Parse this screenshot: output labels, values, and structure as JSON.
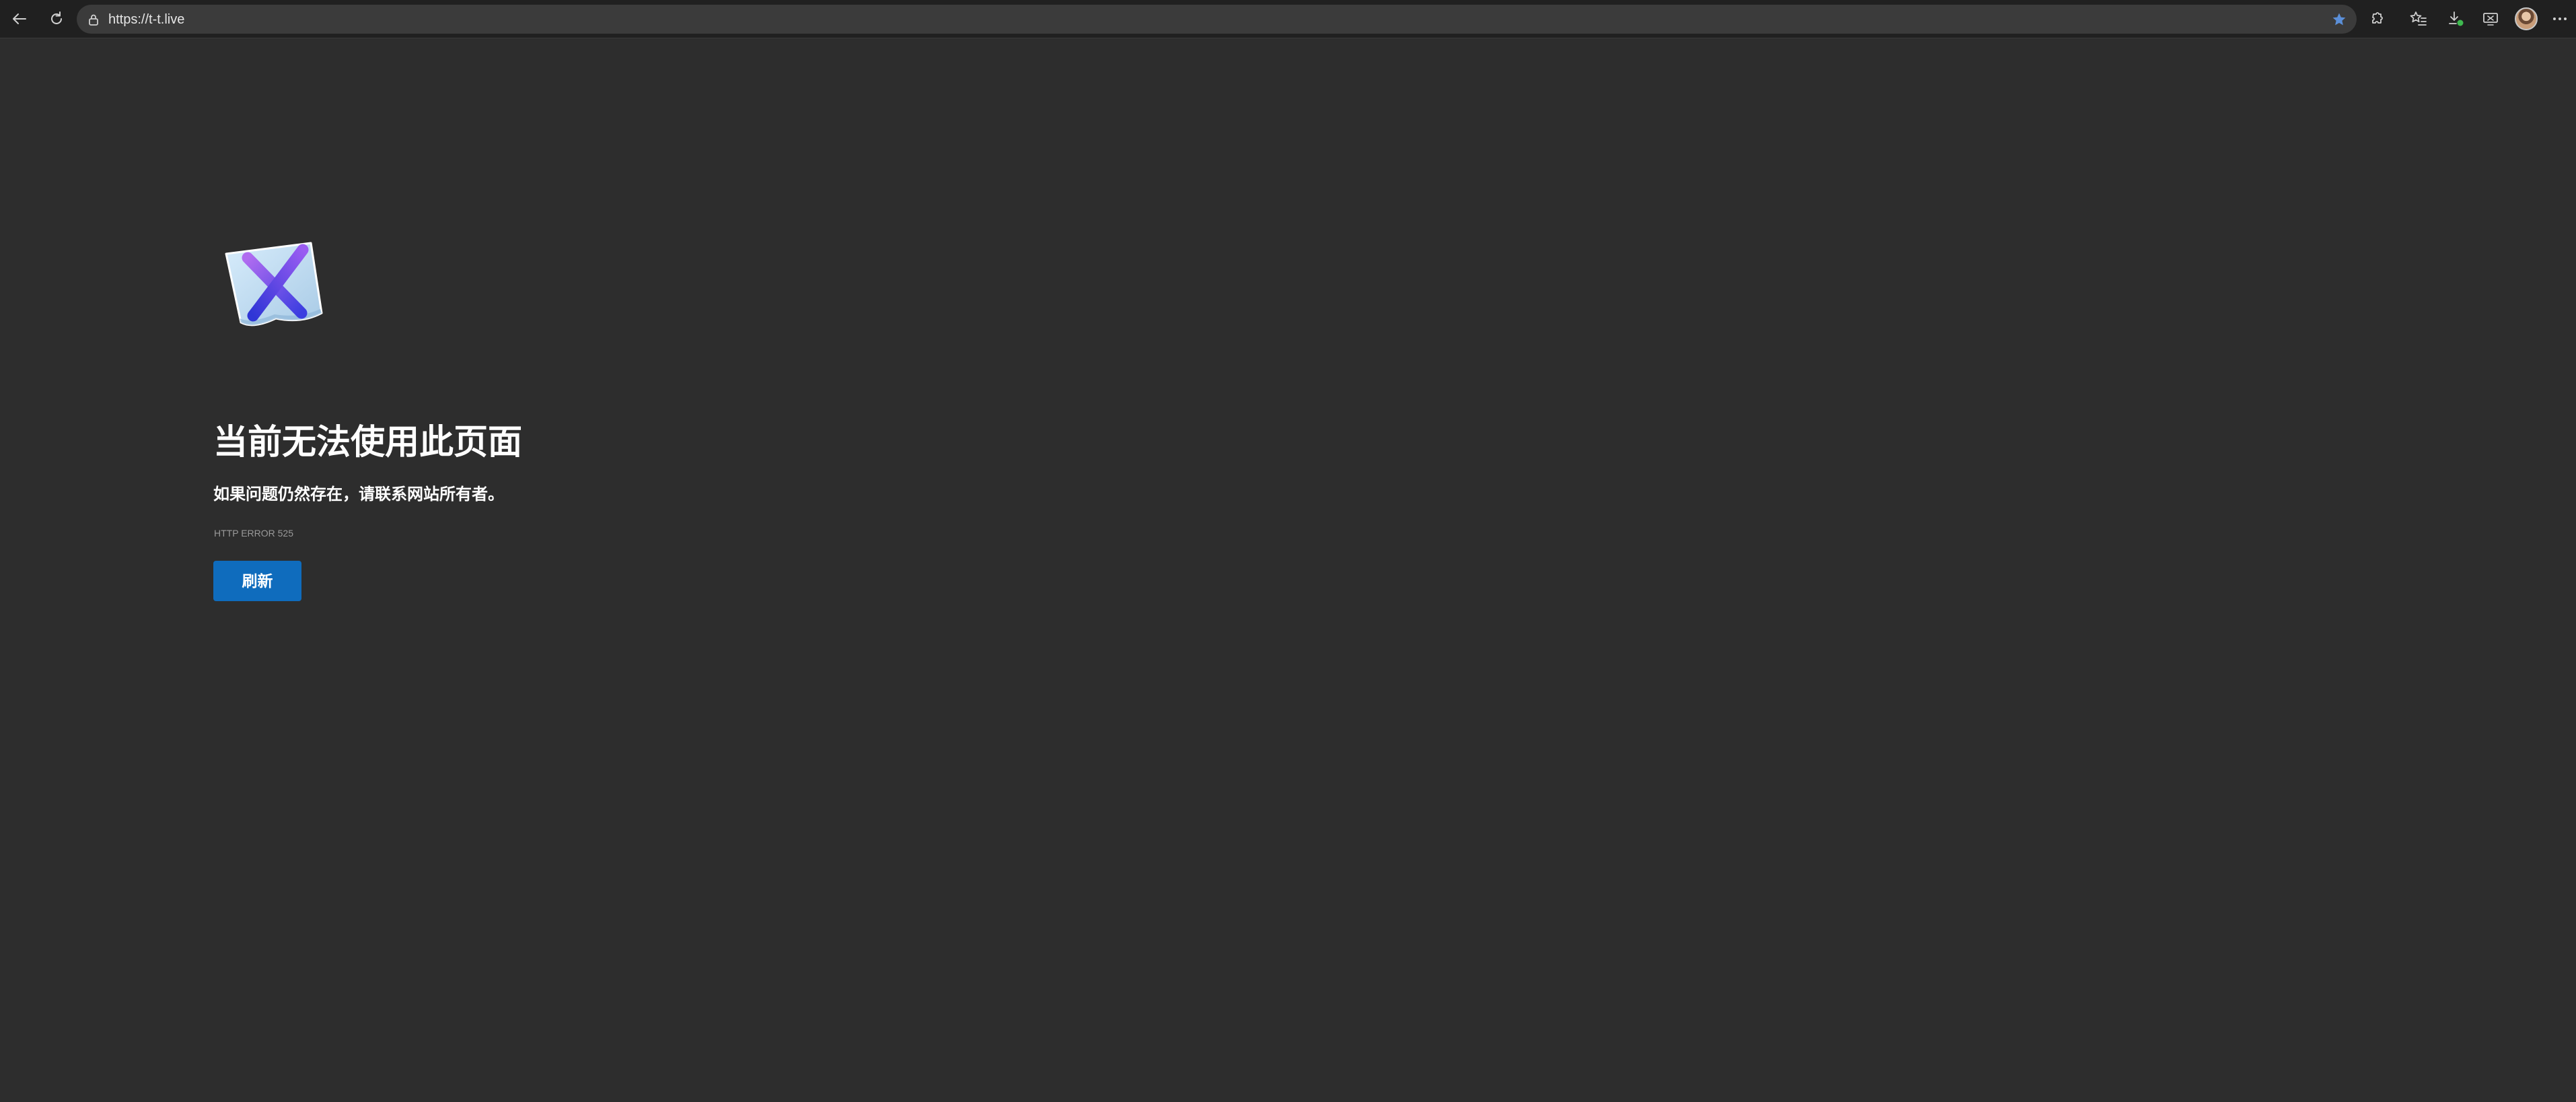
{
  "browser": {
    "address_bar": {
      "url": "https://t-t.live"
    },
    "icons": {
      "back": "back-arrow-icon",
      "refresh": "refresh-icon",
      "site_info": "lock-icon",
      "favorite": "star-filled-icon",
      "extensions": "extensions-icon",
      "favorites": "favorites-list-icon",
      "downloads": "downloads-icon",
      "screen_share": "screen-cast-icon",
      "profile": "profile-avatar",
      "more": "more-ellipsis-icon"
    },
    "accent_color": "#5b8fd8"
  },
  "page": {
    "title": "当前无法使用此页面",
    "message": "如果问题仍然存在，请联系网站所有者。",
    "error_code": "HTTP ERROR 525",
    "refresh_button": "刷新",
    "illustration": "error-page-x-icon",
    "button_color": "#0f6cbd",
    "background_color": "#2d2d2d"
  }
}
